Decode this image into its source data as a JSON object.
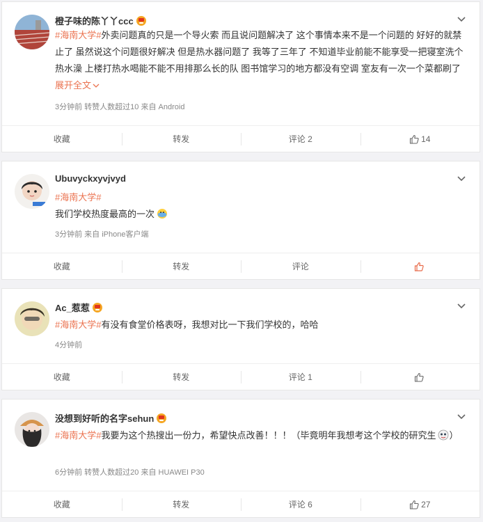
{
  "posts": [
    {
      "username": "橙子味的陈丫丫ccc",
      "tag": "#海南大学#",
      "text": "外卖问题真的只是一个导火索 而且说问题解决了 这个事情本来不是一个问题的 好好的就禁止了 虽然说这个问题很好解决 但是热水器问题了 我等了三年了 不知道毕业前能不能享受一把寝室洗个热水澡 上楼打热水喝能不能不用排那么长的队 图书馆学习的地方都没有空调 室友有一次一个菜都刷了",
      "expand": "展开全文",
      "meta": "3分钟前 转赞人数超过10 来自 Android",
      "actions": {
        "collect": "收藏",
        "repost": "转发",
        "comment": "评论 2",
        "like": "14"
      }
    },
    {
      "username": "Ubuvyckxyvjvyd",
      "tag": "#海南大学#",
      "text": "我们学校热度最高的一次",
      "meta": "3分钟前 来自 iPhone客户端",
      "actions": {
        "collect": "收藏",
        "repost": "转发",
        "comment": "评论",
        "like": ""
      }
    },
    {
      "username": "Ac_惹惹",
      "tag": "#海南大学#",
      "text": "有没有食堂价格表呀，我想对比一下我们学校的，哈哈",
      "meta": "4分钟前",
      "actions": {
        "collect": "收藏",
        "repost": "转发",
        "comment": "评论 1",
        "like": ""
      }
    },
    {
      "username": "没想到好听的名字sehun",
      "tag": "#海南大学#",
      "text": "我要为这个热搜出一份力，希望快点改善！！！（毕竟明年我想考这个学校的研究生",
      "text_end": "）",
      "meta": "6分钟前 转赞人数超过20 来自 HUAWEI P30",
      "actions": {
        "collect": "收藏",
        "repost": "转发",
        "comment": "评论 6",
        "like": "27"
      }
    }
  ],
  "colors": {
    "accent": "#eb7350",
    "like_active": "#e86b4a"
  },
  "icons": [
    "chevron-down-icon",
    "thumb-up-icon",
    "vip-crown-icon",
    "smile-emoji-icon",
    "face-emoji-icon"
  ]
}
